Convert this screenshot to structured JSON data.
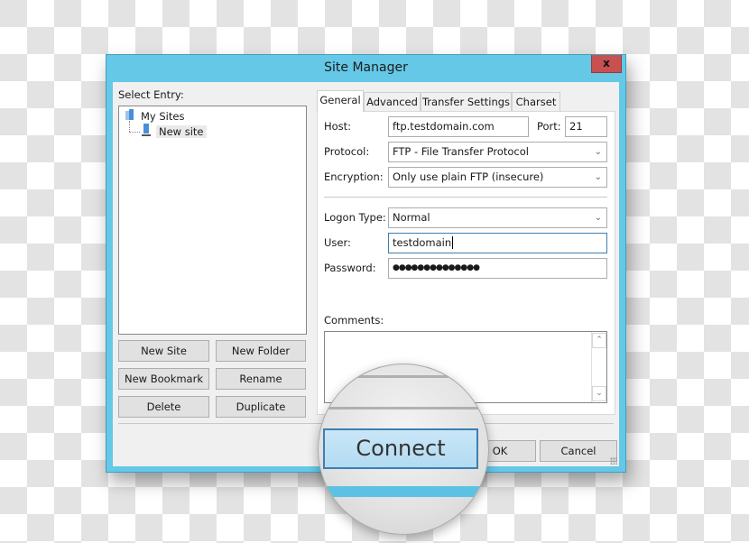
{
  "window": {
    "title": "Site Manager",
    "close_label": "x",
    "accent_color": "#65c8e6",
    "close_color": "#c75050"
  },
  "left": {
    "select_entry_label": "Select Entry:",
    "tree": [
      {
        "label": "My Sites",
        "icon": "folder-icon",
        "level": 0
      },
      {
        "label": "New site",
        "icon": "server-icon",
        "level": 1,
        "selected": true
      }
    ],
    "buttons": {
      "new_site": "New Site",
      "new_folder": "New Folder",
      "new_bookmark": "New Bookmark",
      "rename": "Rename",
      "delete": "Delete",
      "duplicate": "Duplicate"
    }
  },
  "tabs": [
    {
      "label": "General",
      "active": true
    },
    {
      "label": "Advanced",
      "active": false
    },
    {
      "label": "Transfer Settings",
      "active": false
    },
    {
      "label": "Charset",
      "active": false
    }
  ],
  "general": {
    "host_label": "Host:",
    "host_value": "ftp.testdomain.com",
    "port_label": "Port:",
    "port_value": "21",
    "protocol_label": "Protocol:",
    "protocol_value": "FTP - File Transfer Protocol",
    "encryption_label": "Encryption:",
    "encryption_value": "Only use plain FTP (insecure)",
    "logon_type_label": "Logon Type:",
    "logon_type_value": "Normal",
    "user_label": "User:",
    "user_value": "testdomain",
    "password_label": "Password:",
    "password_value": "●●●●●●●●●●●●●●",
    "comments_label": "Comments:",
    "comments_value": ""
  },
  "footer": {
    "connect_label": "Connect",
    "ok_label": "OK",
    "cancel_label": "Cancel"
  }
}
